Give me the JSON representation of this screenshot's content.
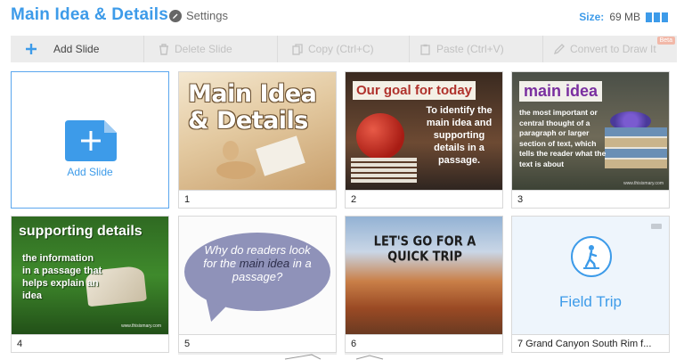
{
  "header": {
    "title": "Main Idea & Details",
    "settings_label": "Settings",
    "size_label": "Size:",
    "size_value": "69 MB"
  },
  "toolbar": {
    "add_slide": "Add Slide",
    "delete_slide": "Delete Slide",
    "copy": "Copy (Ctrl+C)",
    "paste": "Paste (Ctrl+V)",
    "convert": "Convert to Draw It",
    "beta_badge": "Beta"
  },
  "add_card": {
    "label": "Add Slide"
  },
  "slides": [
    {
      "number": "1",
      "caption": "1",
      "title_text": "Main Idea & Details"
    },
    {
      "number": "2",
      "caption": "2",
      "banner": "Our goal for today",
      "body": "To identify the main idea and supporting details in a passage."
    },
    {
      "number": "3",
      "caption": "3",
      "banner": "main idea",
      "body": "the most important or central thought of a paragraph or larger section of text, which tells the reader what the text is about",
      "footer": "www.thisismary.com"
    },
    {
      "number": "4",
      "caption": "4",
      "banner": "supporting details",
      "body": "the information in a passage that helps explain an idea",
      "footer": "www.thisismary.com"
    },
    {
      "number": "5",
      "caption": "5",
      "question_before": "Why do readers look for the",
      "question_highlight": "main idea",
      "question_after": "in a passage?"
    },
    {
      "number": "6",
      "caption": "6",
      "title_text": "LET'S GO FOR A QUICK TRIP"
    },
    {
      "number": "7",
      "caption": "7   Grand Canyon South Rim f...",
      "title_text": "Field Trip"
    }
  ],
  "colors": {
    "accent": "#3d9be9",
    "toolbar_bg": "#ececec",
    "disabled_text": "#c2c2c2"
  }
}
